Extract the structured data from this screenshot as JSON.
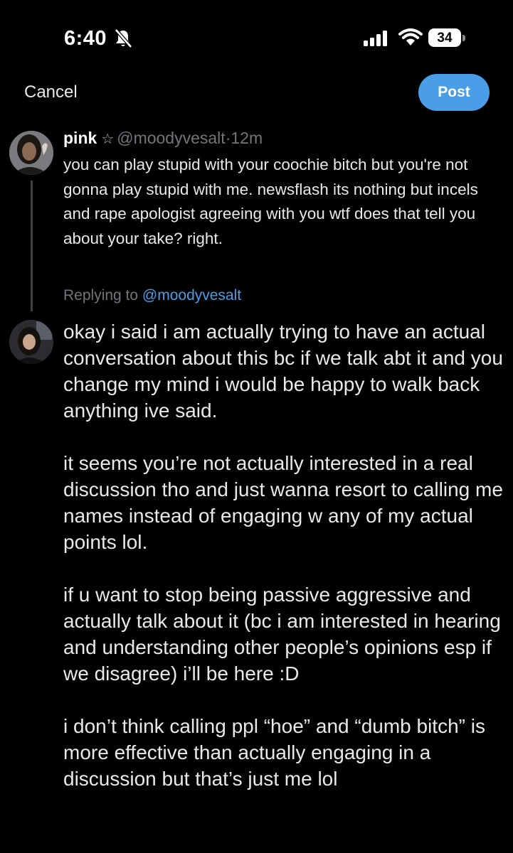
{
  "status_bar": {
    "time": "6:40",
    "battery_level": "34",
    "icons": [
      "bell-muted-icon",
      "signal-icon",
      "wifi-icon",
      "battery-icon"
    ]
  },
  "compose": {
    "cancel_label": "Cancel",
    "post_label": "Post",
    "post_color": "#4a9ee7"
  },
  "original_tweet": {
    "display_name": "pink",
    "star": "☆",
    "handle": "@moodyvesalt",
    "separator": "·",
    "age": "12m",
    "text": "you can play stupid with your coochie bitch but you're not gonna play stupid with me. newsflash its nothing but incels and rape apologist agreeing with you wtf does that tell you about your take? right."
  },
  "reply": {
    "replying_to_prefix": "Replying to",
    "replying_to_handle": "@moodyvesalt",
    "paragraphs": [
      "okay i said i am actually trying to have an actual conversation about this bc if we talk abt it and you change my mind i would be happy to walk back anything ive said.",
      "it seems you’re not actually interested in a real discussion tho and just wanna resort to calling me names instead of engaging w any of my actual points lol.",
      "if u want to stop being passive aggressive and actually talk about it (bc i am interested in hearing and understanding other people’s opinions esp if we disagree) i’ll be here :D",
      "i don’t think calling ppl “hoe” and “dumb bitch” is more effective than actually engaging in a discussion but that’s just me lol"
    ]
  }
}
